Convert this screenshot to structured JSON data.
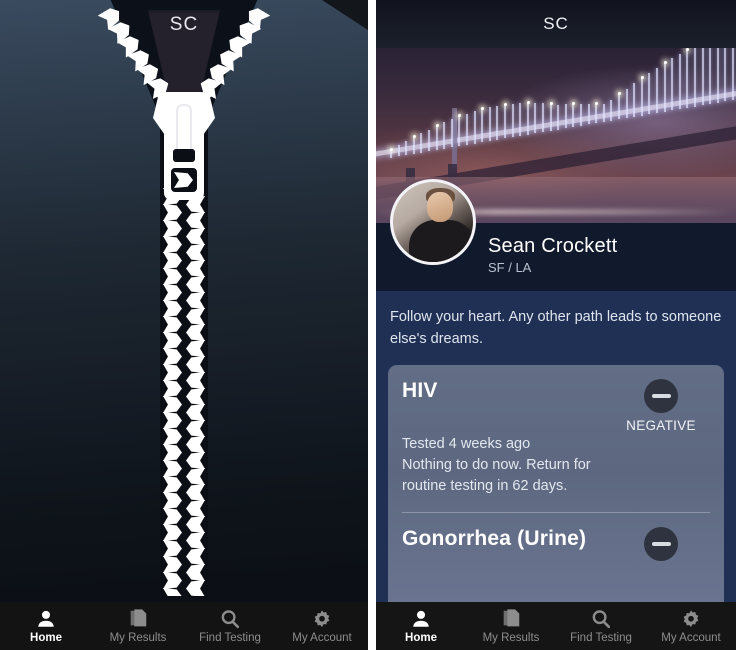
{
  "app": {
    "logo": "SC"
  },
  "left_panel": {
    "name": "splash-zipper-screen",
    "logo": "SC"
  },
  "right_panel": {
    "status_bar_title": "SC",
    "hero": {
      "icon": "bay-bridge-night-photo"
    },
    "profile": {
      "avatar_icon": "user-avatar-photo",
      "name": "Sean Crockett",
      "location": "SF / LA",
      "bio": "Follow your heart. Any other path leads to someone else's dreams."
    },
    "results": [
      {
        "test": "HIV",
        "tested": "Tested 4 weeks ago",
        "note": "Nothing to do now. Return for routine testing in 62 days.",
        "status": "NEGATIVE",
        "status_icon": "minus-circle-icon"
      },
      {
        "test": "Gonorrhea (Urine)",
        "tested": "",
        "note": "",
        "status": "",
        "status_icon": "minus-circle-icon"
      }
    ]
  },
  "tabbar": {
    "tabs": [
      {
        "label": "Home",
        "icon": "person-icon",
        "active": true
      },
      {
        "label": "My Results",
        "icon": "documents-icon",
        "active": false
      },
      {
        "label": "Find Testing",
        "icon": "search-icon",
        "active": false
      },
      {
        "label": "My Account",
        "icon": "gear-icon",
        "active": false
      }
    ]
  },
  "colors": {
    "card_bg": "#5f6b84",
    "bio_bg": "#1f3054",
    "identity_bg": "#111a2c",
    "tabbar_bg": "#151515",
    "accent_text": "#ffffff",
    "inactive_text": "#8d8d8d"
  }
}
